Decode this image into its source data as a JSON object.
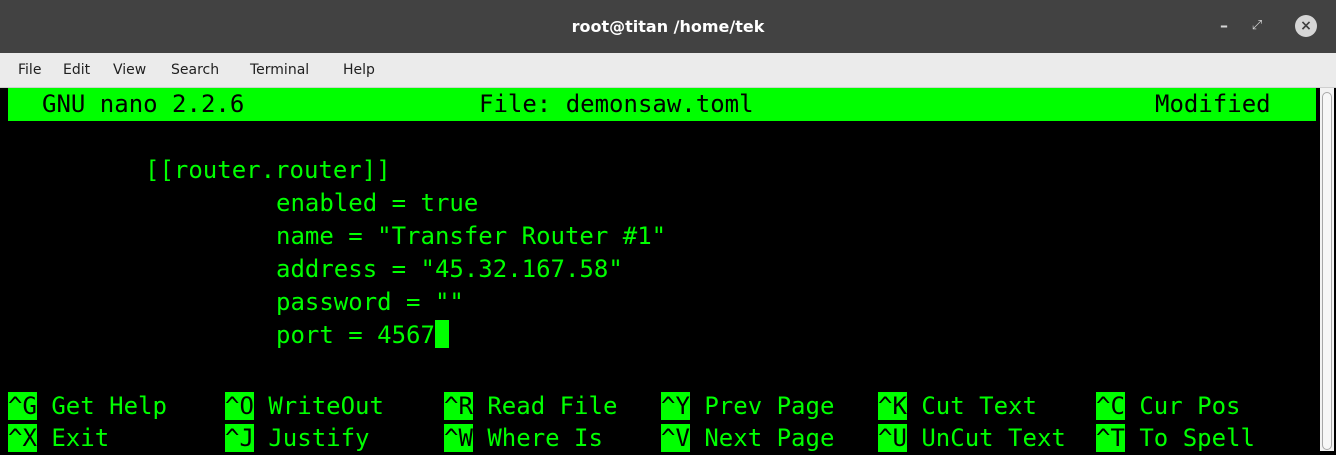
{
  "window": {
    "title": "root@titan /home/tek"
  },
  "menu": [
    "File",
    "Edit",
    "View",
    "Search",
    "Terminal",
    "Help"
  ],
  "nano": {
    "version": "GNU nano 2.2.6",
    "file": "File: demonsaw.toml",
    "status": "Modified"
  },
  "code_lines": [
    "[[router.router]]",
    "enabled = true",
    "name = \"Transfer Router #1\"",
    "address = \"45.32.167.58\"",
    "password = \"\"",
    "port = 4567"
  ],
  "shortcuts": {
    "row1": [
      {
        "key": "^G",
        "label": "Get Help"
      },
      {
        "key": "^O",
        "label": "WriteOut"
      },
      {
        "key": "^R",
        "label": "Read File"
      },
      {
        "key": "^Y",
        "label": "Prev Page"
      },
      {
        "key": "^K",
        "label": "Cut Text"
      },
      {
        "key": "^C",
        "label": "Cur Pos"
      }
    ],
    "row2": [
      {
        "key": "^X",
        "label": "Exit"
      },
      {
        "key": "^J",
        "label": "Justify"
      },
      {
        "key": "^W",
        "label": "Where Is"
      },
      {
        "key": "^V",
        "label": "Next Page"
      },
      {
        "key": "^U",
        "label": "UnCut Text"
      },
      {
        "key": "^T",
        "label": "To Spell"
      }
    ]
  },
  "colors": {
    "terminal_fg": "#00ff00",
    "terminal_bg": "#000000",
    "titlebar": "#424242",
    "menubar": "#ebebeb"
  },
  "icons": [
    "minimize-icon",
    "maximize-icon",
    "close-icon"
  ]
}
